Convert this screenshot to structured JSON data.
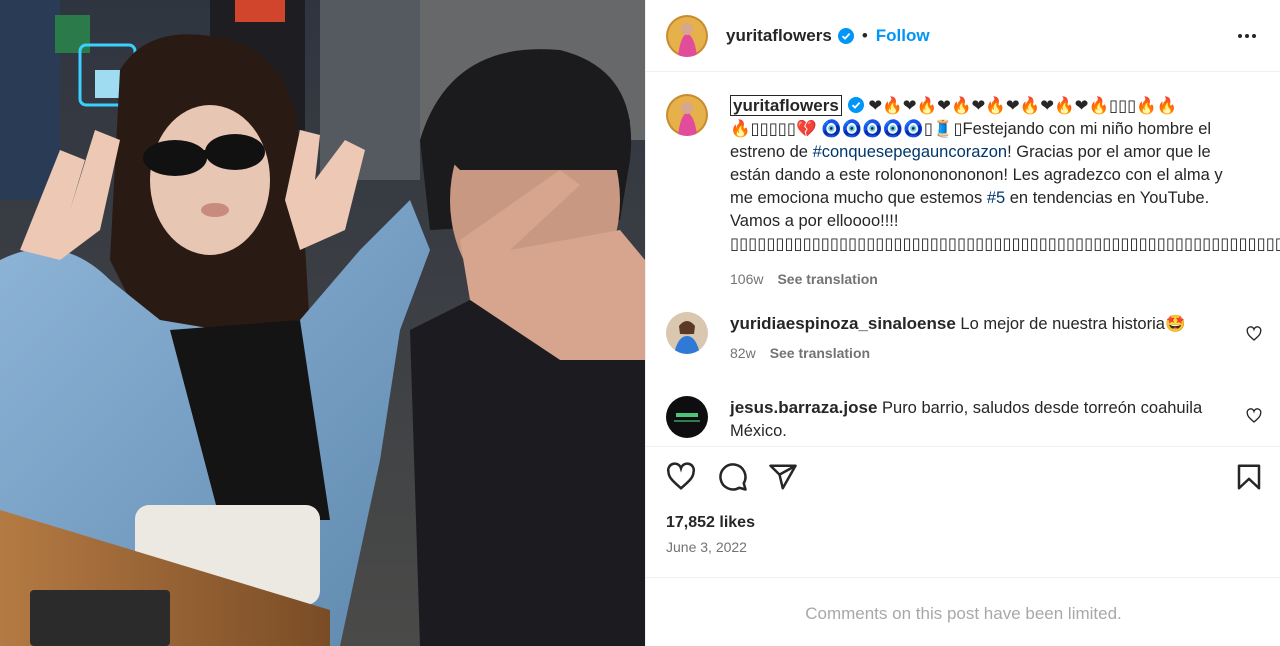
{
  "post": {
    "author": "yuritaflowers",
    "follow_label": "Follow",
    "separator": "•",
    "caption": {
      "username": "yuritaflowers",
      "emoji_line1": "❤🔥❤🔥❤🔥❤🔥❤🔥❤🔥❤🔥▯▯▯🔥🔥",
      "emoji_line2a": "🔥▯▯▯▯▯💔",
      "emoji_line2b": "🧿🧿🧿🧿🧿▯🧵▯",
      "text_before_tag": "Festejando con mi niño hombre el estreno de ",
      "hashtag1": "#conquesepegauncorazon",
      "text_mid": "! Gracias por el amor que le están dando a este rolonononononon! Les agradezco con el alma y me emociona mucho que estemos ",
      "hashtag2": "#5",
      "text_after": " en tendencias en YouTube. Vamos a por elloooo!!!! ▯▯▯▯▯▯▯▯▯▯▯▯▯▯▯▯▯▯▯▯▯▯▯▯▯▯▯▯▯▯▯▯▯▯▯▯▯▯▯▯▯▯▯▯▯▯▯▯▯▯▯▯▯▯▯▯▯▯▯▯▯▯▯",
      "age": "106w",
      "see_translation": "See translation"
    },
    "comments": [
      {
        "username": "yuridiaespinoza_sinaloense",
        "text": " Lo mejor de nuestra historia",
        "emoji": "🤩",
        "age": "82w",
        "see_translation": "See translation"
      },
      {
        "username": "jesus.barraza.jose",
        "text": " Puro barrio, saludos desde torreón coahuila México."
      }
    ],
    "likes": "17,852 likes",
    "date": "June 3, 2022",
    "comments_limited": "Comments on this post have been limited."
  },
  "colors": {
    "follow_blue": "#0095f6",
    "verified_blue": "#0095f6",
    "hashtag": "#00376b",
    "muted": "#737373",
    "text": "#262626"
  },
  "icons": [
    "verified-badge-icon",
    "more-options-icon",
    "heart-icon",
    "comment-icon",
    "share-icon",
    "bookmark-icon"
  ]
}
